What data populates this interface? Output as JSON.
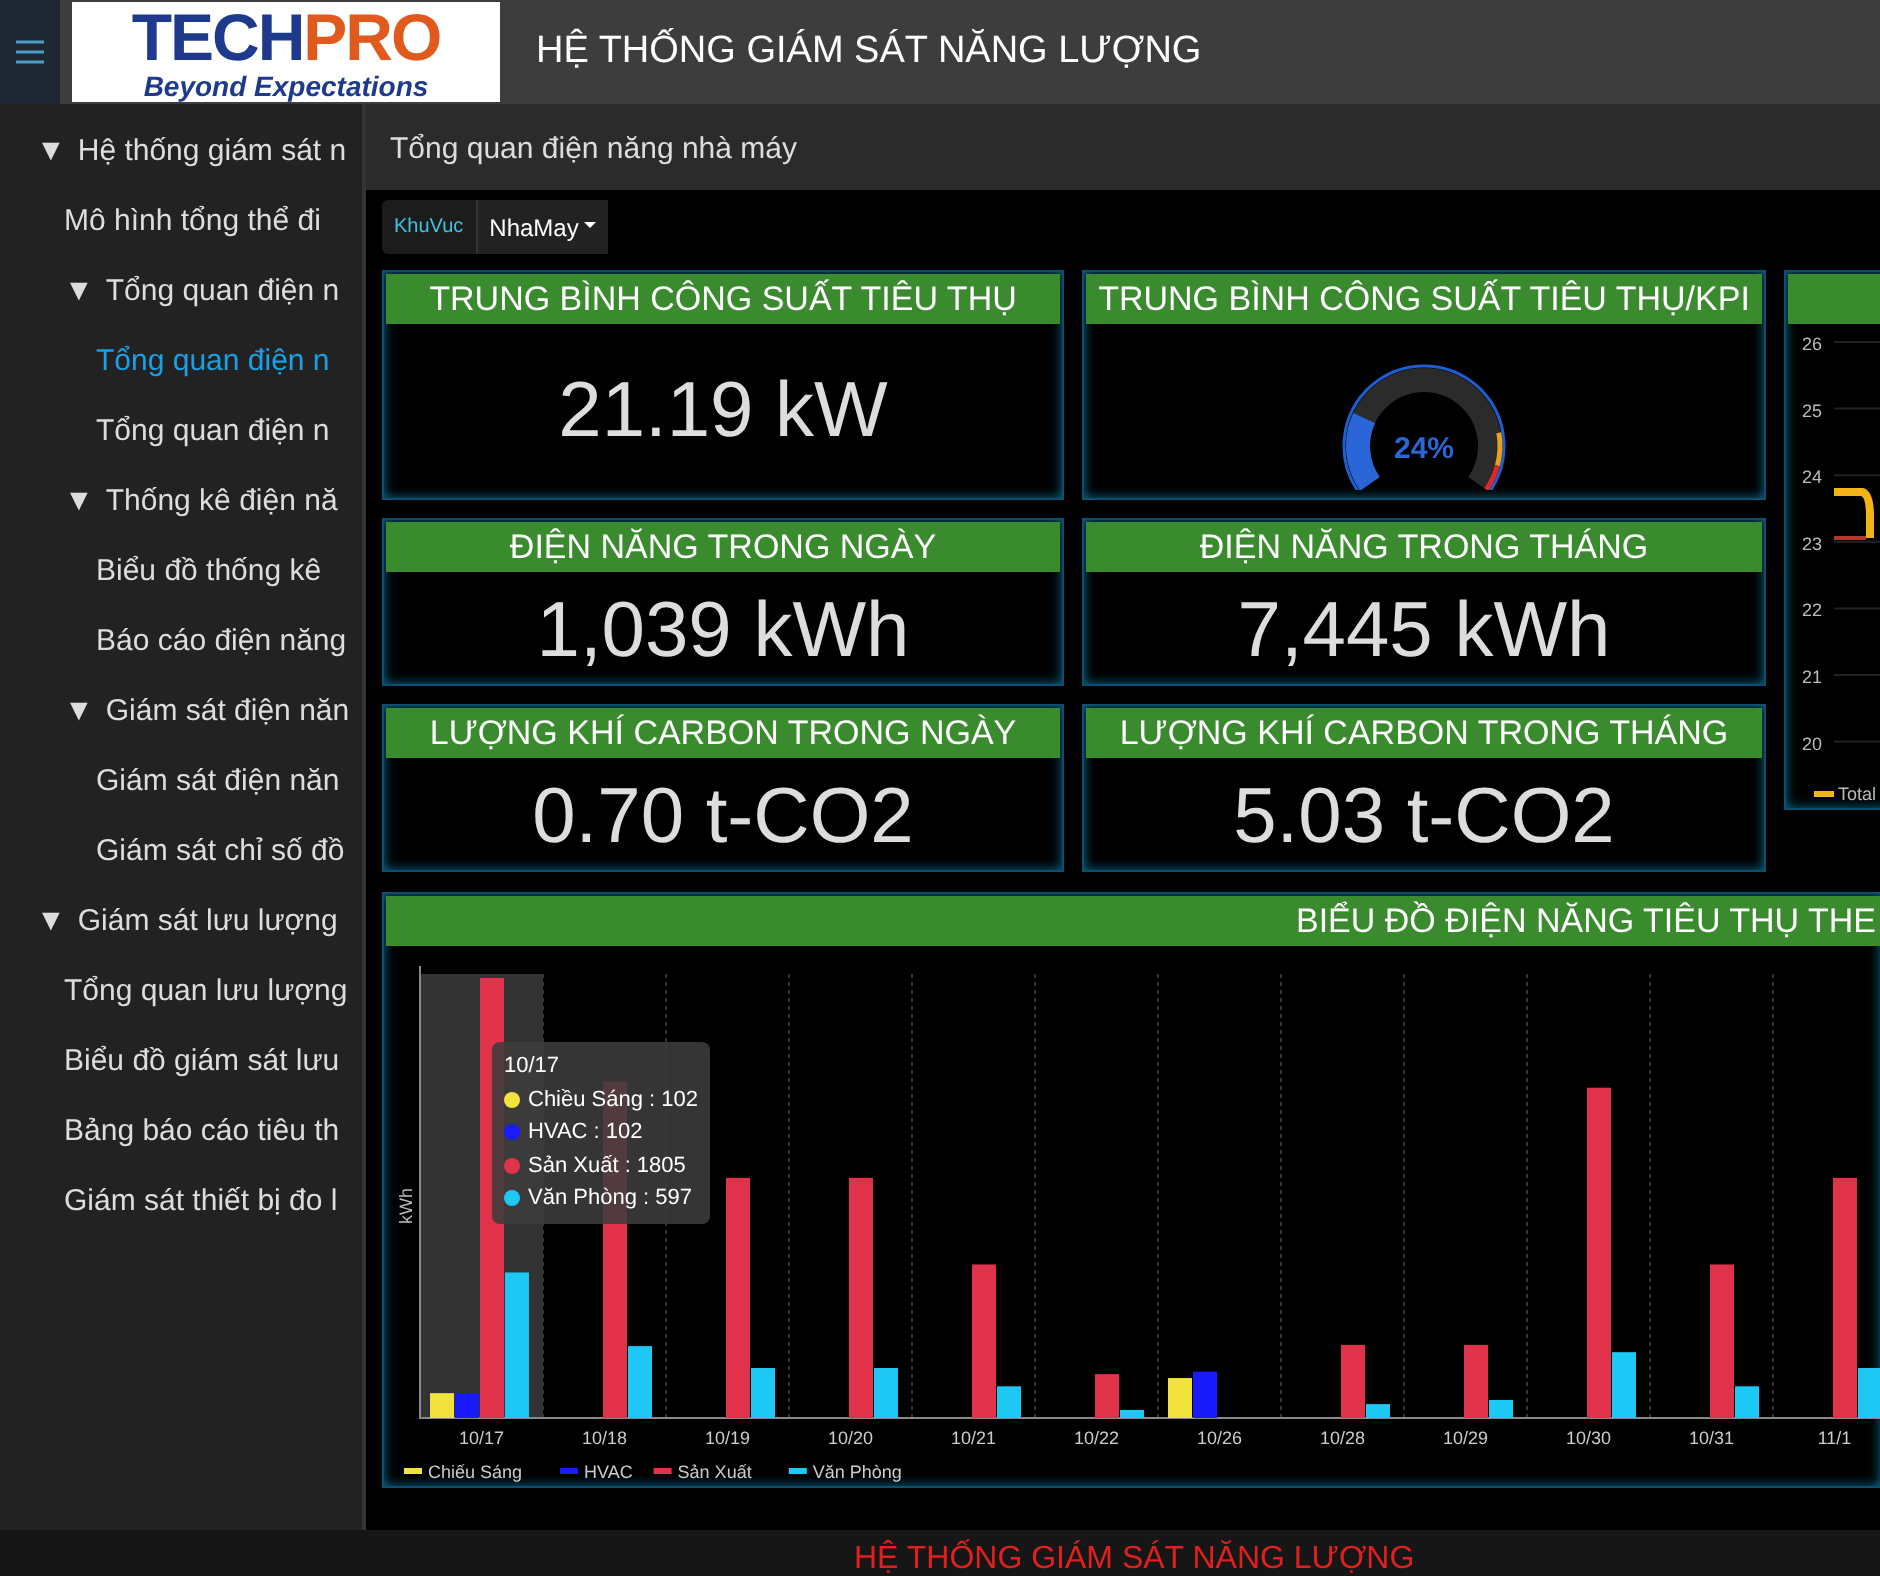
{
  "header": {
    "logo": {
      "brand_part_1": "TECH",
      "brand_part_2": "PRO",
      "tagline": "Beyond Expectations"
    },
    "title": "HỆ THỐNG GIÁM SÁT NĂNG LƯỢNG"
  },
  "sidebar": {
    "items": [
      {
        "toggle": "▼",
        "label": "Hệ thống giám sát n",
        "expanded": true,
        "selected": false,
        "children": [
          {
            "label": "Mô hình tổng thể đi",
            "selected": false
          },
          {
            "toggle": "▼",
            "label": "Tổng quan điện n",
            "expanded": true,
            "selected": false,
            "children": [
              {
                "label": "Tổng quan điện n",
                "selected": true
              },
              {
                "label": "Tổng quan điện n",
                "selected": false
              }
            ]
          },
          {
            "toggle": "▼",
            "label": "Thống kê điện nă",
            "expanded": true,
            "selected": false,
            "children": [
              {
                "label": "Biểu đồ thống kê",
                "selected": false
              },
              {
                "label": "Báo cáo điện năng",
                "selected": false
              }
            ]
          },
          {
            "toggle": "▼",
            "label": "Giám sát điện năn",
            "expanded": true,
            "selected": false,
            "children": [
              {
                "label": "Giám sát điện năn",
                "selected": false
              },
              {
                "label": "Giám sát chỉ số đồ",
                "selected": false
              }
            ]
          }
        ]
      },
      {
        "toggle": "▼",
        "label": "Giám sát lưu lượng",
        "expanded": true,
        "selected": false,
        "children": [
          {
            "label": "Tổng quan lưu lượng",
            "selected": false
          },
          {
            "label": "Biểu đồ giám sát lưu",
            "selected": false
          },
          {
            "label": "Bảng báo cáo tiêu th",
            "selected": false
          },
          {
            "label": "Giám sát thiết bị đo l",
            "selected": false
          }
        ]
      }
    ]
  },
  "breadcrumb": "Tổng quan điện năng nhà máy",
  "filter": {
    "label": "KhuVuc",
    "value": "NhaMay"
  },
  "kpi_cards": [
    {
      "kind": "value",
      "title": "TRUNG BÌNH CÔNG SUẤT TIÊU THỤ",
      "value": "21.19 kW"
    },
    {
      "kind": "gauge",
      "title": "TRUNG BÌNH CÔNG SUẤT TIÊU THỤ/KPI",
      "level": 0.24,
      "reading": "24%"
    },
    {
      "kind": "value",
      "title": "ĐIỆN NĂNG TRONG NGÀY",
      "value": "1,039 kWh"
    },
    {
      "kind": "value",
      "title": "ĐIỆN NĂNG TRONG THÁNG",
      "value": "7,445 kWh"
    },
    {
      "kind": "value",
      "title": "LƯỢNG KHÍ CARBON TRONG NGÀY",
      "value": "0.70 t-CO2"
    },
    {
      "kind": "value",
      "title": "LƯỢNG KHÍ CARBON TRONG THÁNG",
      "value": "5.03 t-CO2"
    }
  ],
  "trend_card": {
    "yticks": [
      "26",
      "25",
      "24",
      "23",
      "22",
      "21",
      "20"
    ],
    "legend": "Total"
  },
  "bar_chart": {
    "title": "BIỂU ĐỒ ĐIỆN NĂNG TIÊU THỤ THE",
    "axis_label": "kWh",
    "categories": [
      "10/17",
      "10/18",
      "10/19",
      "10/20",
      "10/21",
      "10/22",
      "10/26",
      "10/28",
      "10/29",
      "10/30",
      "10/31",
      "11/1"
    ],
    "legend": [
      {
        "label": "Chiếu Sáng",
        "color": "#f2e33c"
      },
      {
        "label": "HVAC",
        "color": "#1a1aff"
      },
      {
        "label": "Sản Xuất",
        "color": "#e0324a"
      },
      {
        "label": "Văn Phòng",
        "color": "#1ec8f5"
      }
    ],
    "tooltip": {
      "title": "10/17",
      "rows": [
        {
          "text": "Chiều Sáng : 102",
          "color": "#f2e33c"
        },
        {
          "text": "HVAC : 102",
          "color": "#1a1aff"
        },
        {
          "text": "Sản Xuất : 1805",
          "color": "#e0324a"
        },
        {
          "text": "Văn Phòng : 597",
          "color": "#1ec8f5"
        }
      ]
    }
  },
  "footer": "HỆ THỐNG GIÁM SÁT NĂNG LƯỢNG"
}
